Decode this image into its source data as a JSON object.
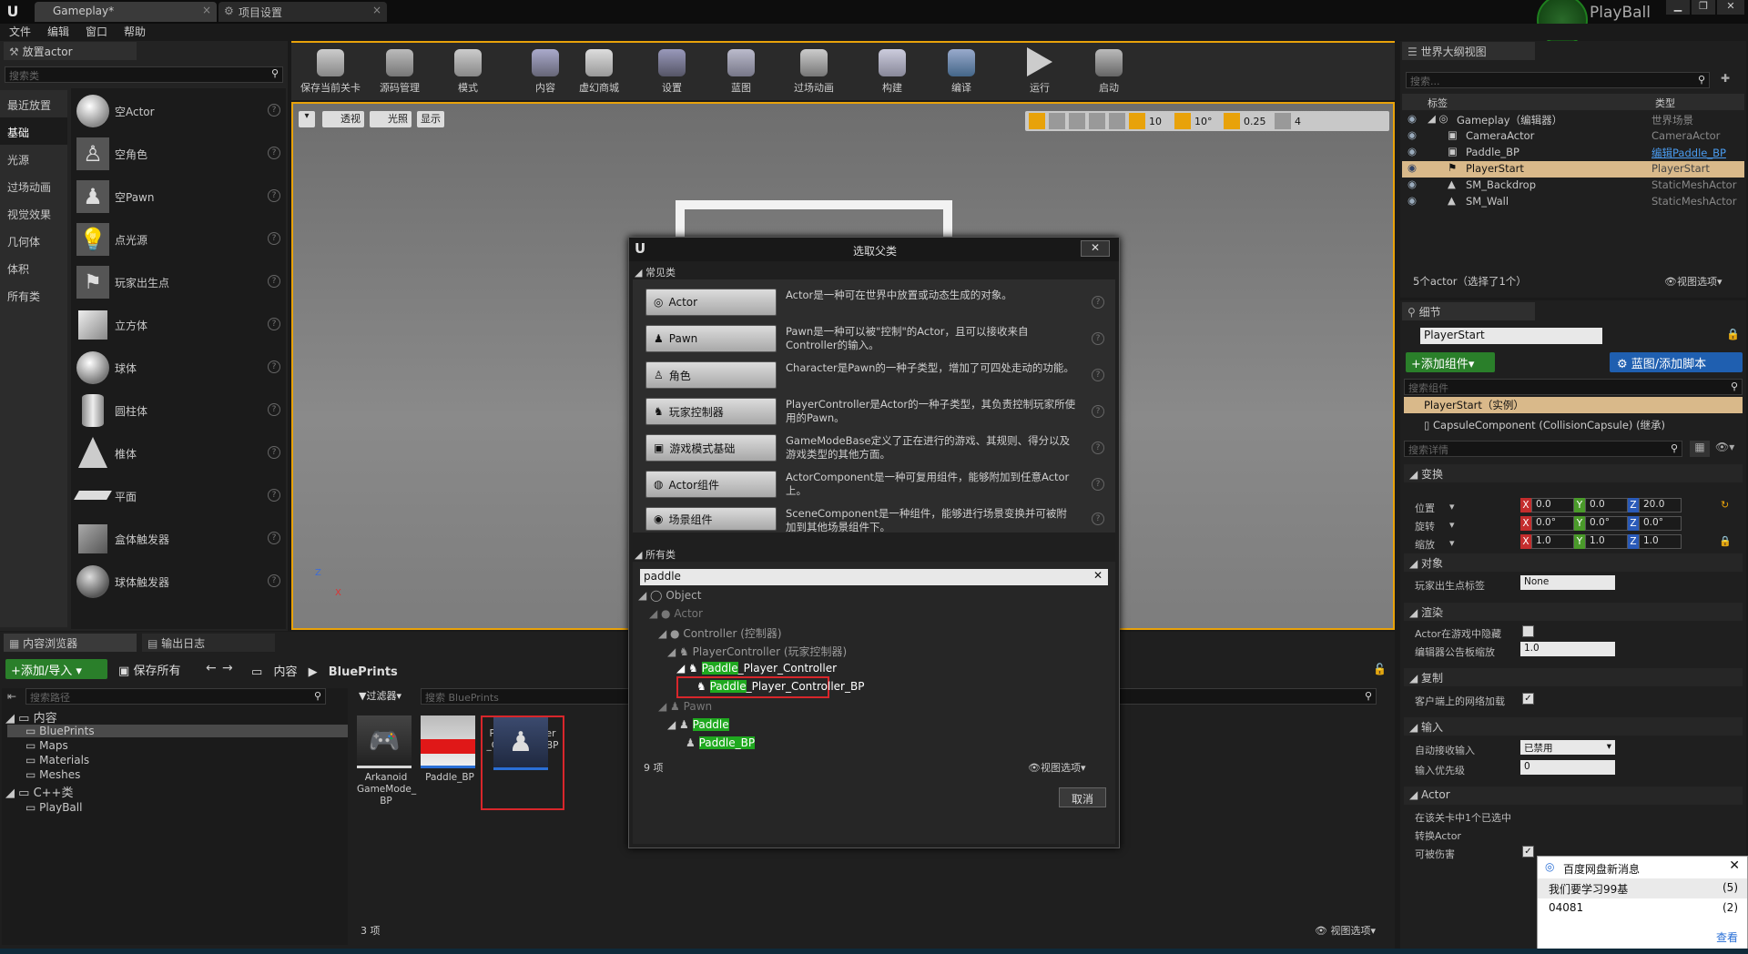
{
  "titlebar": {
    "tab1": "Gameplay*",
    "tab2": "项目设置",
    "project_name": "PlayBall"
  },
  "menu": [
    "文件",
    "编辑",
    "窗口",
    "帮助"
  ],
  "place_panel": {
    "title": "放置actor",
    "search_placeholder": "搜索类",
    "categories": [
      "最近放置",
      "基础",
      "光源",
      "过场动画",
      "视觉效果",
      "几何体",
      "体积",
      "所有类"
    ],
    "items": [
      "空Actor",
      "空角色",
      "空Pawn",
      "点光源",
      "玩家出生点",
      "立方体",
      "球体",
      "圆柱体",
      "椎体",
      "平面",
      "盒体触发器",
      "球体触发器"
    ]
  },
  "toolbar": [
    "保存当前关卡",
    "源码管理",
    "模式",
    "内容",
    "虚幻商城",
    "设置",
    "蓝图",
    "过场动画",
    "构建",
    "编译",
    "运行",
    "启动"
  ],
  "viewport": {
    "perspective": "透视",
    "lit": "光照",
    "show": "显示",
    "grid": "10",
    "rot": "10°",
    "scale": "0.25",
    "cam": "4"
  },
  "dialog": {
    "title": "选取父类",
    "common_header": "常见类",
    "common": [
      {
        "label": "Actor",
        "desc": "Actor是一种可在世界中放置或动态生成的对象。"
      },
      {
        "label": "Pawn",
        "desc": "Pawn是一种可以被\"控制\"的Actor，且可以接收来自Controller的输入。"
      },
      {
        "label": "角色",
        "desc": "Character是Pawn的一种子类型，增加了可四处走动的功能。"
      },
      {
        "label": "玩家控制器",
        "desc": "PlayerController是Actor的一种子类型，其负责控制玩家所使用的Pawn。"
      },
      {
        "label": "游戏模式基础",
        "desc": "GameModeBase定义了正在进行的游戏、其规则、得分以及游戏类型的其他方面。"
      },
      {
        "label": "Actor组件",
        "desc": "ActorComponent是一种可复用组件，能够附加到任意Actor上。"
      },
      {
        "label": "场景组件",
        "desc": "SceneComponent是一种组件，能够进行场景变换并可被附加到其他场景组件下。"
      }
    ],
    "all_header": "所有类",
    "search_value": "paddle",
    "tree": {
      "object": "Object",
      "actor": "Actor",
      "controller": "Controller (控制器)",
      "player_controller": "PlayerController (玩家控制器)",
      "paddle_pc_hl": "Paddle",
      "paddle_pc_rest": "_Player_Controller",
      "paddle_pc_bp_hl": "Paddle",
      "paddle_pc_bp_rest": "_Player_Controller_BP",
      "pawn": "Pawn",
      "paddle": "Paddle",
      "paddle_bp_hl": "Paddle",
      "paddle_bp_rest": "_BP"
    },
    "count": "9 项",
    "view_options": "视图选项",
    "cancel": "取消"
  },
  "content_browser": {
    "tab1": "内容浏览器",
    "tab2": "输出日志",
    "add_import": "添加/导入",
    "save_all": "保存所有",
    "breadcrumb_root": "内容",
    "breadcrumb_current": "BluePrints",
    "search_paths": "搜索路径",
    "filter": "过滤器",
    "search_assets": "搜索 BluePrints",
    "folders": {
      "content": "内容",
      "blueprints": "BluePrints",
      "maps": "Maps",
      "materials": "Materials",
      "meshes": "Meshes",
      "cpp": "C++类",
      "playball": "PlayBall"
    },
    "assets": [
      "Arkanoid GameMode_ BP",
      "Paddle_BP",
      "Paddle_Player _Controller_ BP"
    ],
    "count": "3 项",
    "view_options": "视图选项"
  },
  "outliner": {
    "title": "世界大纲视图",
    "search_placeholder": "搜索...",
    "col_label": "标签",
    "col_type": "类型",
    "rows": [
      {
        "label": "Gameplay（编辑器）",
        "type": "世界场景"
      },
      {
        "label": "CameraActor",
        "type": "CameraActor"
      },
      {
        "label": "Paddle_BP",
        "type": "编辑Paddle_BP"
      },
      {
        "label": "PlayerStart",
        "type": "PlayerStart"
      },
      {
        "label": "SM_Backdrop",
        "type": "StaticMeshActor"
      },
      {
        "label": "SM_Wall",
        "type": "StaticMeshActor"
      }
    ],
    "footer": "5个actor（选择了1个）",
    "view_options": "视图选项"
  },
  "details": {
    "title": "细节",
    "name": "PlayerStart",
    "add_component": "添加组件",
    "blueprint_btn": "蓝图/添加脚本",
    "search_components": "搜索组件",
    "instance": "PlayerStart（实例）",
    "capsule": "CapsuleComponent (CollisionCapsule) (继承)",
    "search_details": "搜索详情",
    "transform": "变换",
    "location": "位置",
    "rotation": "旋转",
    "scale": "缩放",
    "loc": [
      "0.0",
      "0.0",
      "20.0"
    ],
    "rot": [
      "0.0°",
      "0.0°",
      "0.0°"
    ],
    "scl": [
      "1.0",
      "1.0",
      "1.0"
    ],
    "object": "对象",
    "player_start_tag": "玩家出生点标签",
    "none": "None",
    "render": "渲染",
    "hidden_in_game": "Actor在游戏中隐藏",
    "billboard_scale": "编辑器公告板缩放",
    "billboard_val": "1.0",
    "replication": "复制",
    "net_load": "客户端上的网络加载",
    "input": "输入",
    "auto_receive": "自动接收输入",
    "auto_receive_val": "已禁用",
    "input_priority": "输入优先级",
    "input_priority_val": "0",
    "actor": "Actor",
    "spawn_line": "在该关卡中1个已选中",
    "convert_actor": "转换Actor",
    "can_be_damaged": "可被伤害"
  },
  "notification": {
    "title": "百度网盘新消息",
    "line1": "我们要学习99基",
    "count1": "(5)",
    "line2": "04081",
    "count2": "(2)",
    "link": "查看"
  }
}
